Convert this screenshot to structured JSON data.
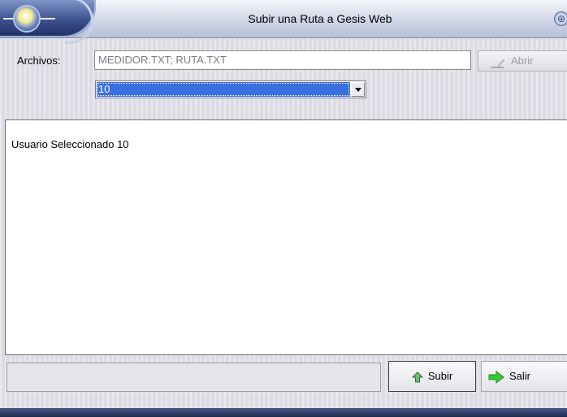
{
  "window": {
    "title": "Subir una Ruta a Gesis Web",
    "title_button_symbol": "⊕"
  },
  "form": {
    "archivos_label": "Archivos:",
    "archivos_value": "MEDIDOR.TXT; RUTA.TXT",
    "abrir_label": "Abrir",
    "user_select_value": "10"
  },
  "message": {
    "text": "Usuario Seleccionado 10"
  },
  "status": {
    "text": ""
  },
  "buttons": {
    "subir_label": "Subir",
    "salir_label": "Salir"
  },
  "icons": {
    "orb": "app-orb-icon",
    "abrir": "open-file-icon",
    "subir": "up-arrow-icon",
    "salir": "green-right-arrow-icon"
  },
  "colors": {
    "selection": "#3a6fe0",
    "salir_arrow": "#33cc33",
    "subir_arrow": "#3a7a3a"
  }
}
